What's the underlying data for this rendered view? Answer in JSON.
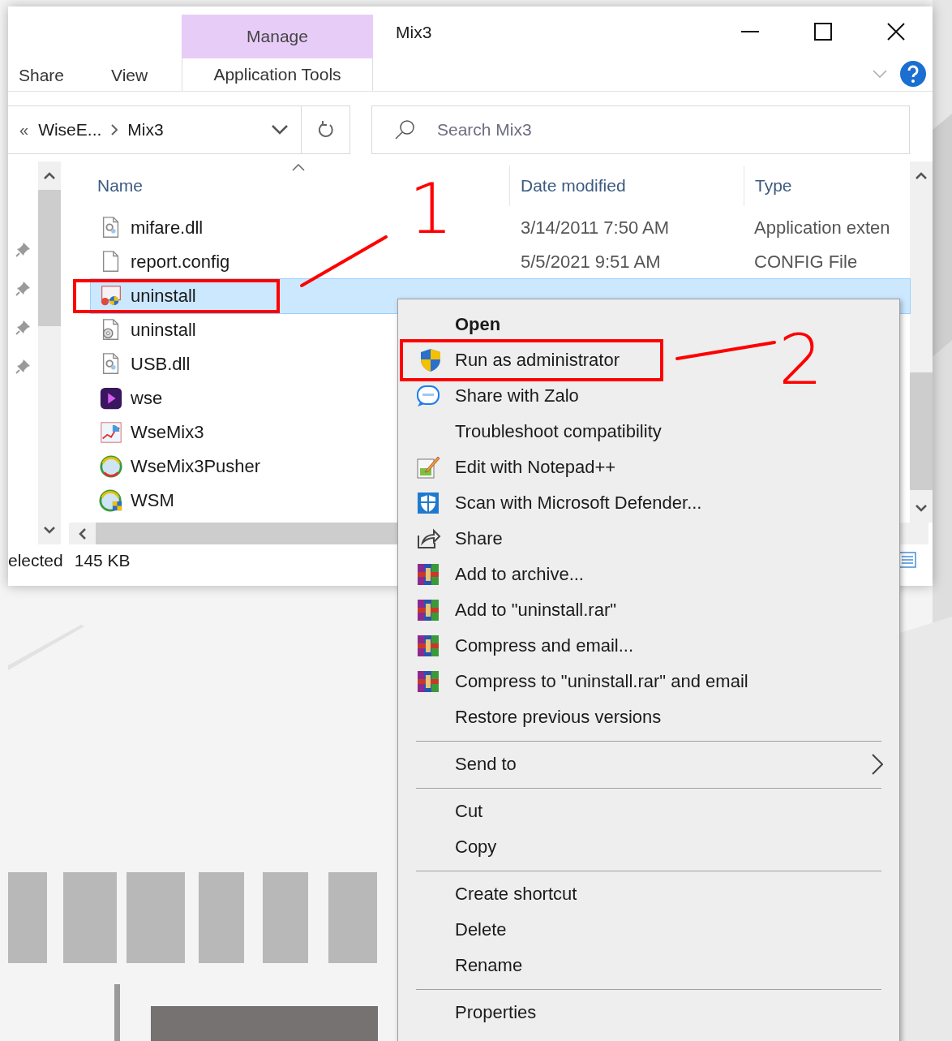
{
  "window": {
    "title": "Mix3"
  },
  "ribbon": {
    "context_header": "Manage",
    "tabs": [
      {
        "label": "Share",
        "selected": false,
        "kind": "plain"
      },
      {
        "label": "View",
        "selected": false,
        "kind": "plain"
      },
      {
        "label": "Application Tools",
        "selected": false,
        "kind": "context"
      }
    ]
  },
  "address_bar": {
    "overflow": "«",
    "crumbs": [
      "WiseE...",
      "Mix3"
    ]
  },
  "search": {
    "placeholder": "Search Mix3"
  },
  "file_list": {
    "columns": [
      "Name",
      "Date modified",
      "Type"
    ],
    "rows": [
      {
        "name": "mifare.dll",
        "kind": "dll",
        "date": "3/14/2011 7:50 AM",
        "type": "Application exten",
        "selected": false
      },
      {
        "name": "report.config",
        "kind": "blank",
        "date": "5/5/2021 9:51 AM",
        "type": "CONFIG File",
        "selected": false
      },
      {
        "name": "uninstall",
        "kind": "installer",
        "selected": true,
        "callout": "1"
      },
      {
        "name": "uninstall",
        "kind": "settings",
        "selected": false
      },
      {
        "name": "USB.dll",
        "kind": "dll",
        "selected": false
      },
      {
        "name": "wse",
        "kind": "video-app",
        "selected": false
      },
      {
        "name": "WseMix3",
        "kind": "chart-app",
        "selected": false
      },
      {
        "name": "WseMix3Pusher",
        "kind": "globe-app",
        "selected": false
      },
      {
        "name": "WSM",
        "kind": "globe-shield-app",
        "selected": false
      }
    ]
  },
  "status_bar": {
    "selection": "elected",
    "size": "145 KB"
  },
  "context_menu": {
    "items": [
      {
        "kind": "item",
        "label": "Open",
        "default": true
      },
      {
        "kind": "shield",
        "label": "Run as administrator",
        "default": false,
        "callout": "2"
      },
      {
        "kind": "chat",
        "label": "Share with Zalo",
        "default": false
      },
      {
        "kind": "item",
        "label": "Troubleshoot compatibility",
        "default": false
      },
      {
        "kind": "notepad",
        "label": "Edit with Notepad++",
        "default": false
      },
      {
        "kind": "defender",
        "label": "Scan with Microsoft Defender...",
        "default": false
      },
      {
        "kind": "share",
        "label": "Share",
        "default": false
      },
      {
        "kind": "archive",
        "label": "Add to archive...",
        "default": false
      },
      {
        "kind": "archive",
        "label": "Add to \"uninstall.rar\"",
        "default": false
      },
      {
        "kind": "archive",
        "label": "Compress and email...",
        "default": false
      },
      {
        "kind": "archive",
        "label": "Compress to \"uninstall.rar\" and email",
        "default": false
      },
      {
        "kind": "item",
        "label": "Restore previous versions",
        "default": false
      },
      {
        "kind": "separator"
      },
      {
        "kind": "submenu",
        "label": "Send to",
        "default": false
      },
      {
        "kind": "separator"
      },
      {
        "kind": "item",
        "label": "Cut",
        "default": false
      },
      {
        "kind": "item",
        "label": "Copy",
        "default": false
      },
      {
        "kind": "separator"
      },
      {
        "kind": "item",
        "label": "Create shortcut",
        "default": false
      },
      {
        "kind": "item",
        "label": "Delete",
        "default": false
      },
      {
        "kind": "item",
        "label": "Rename",
        "default": false
      },
      {
        "kind": "separator"
      },
      {
        "kind": "item",
        "label": "Properties",
        "default": false
      }
    ]
  }
}
